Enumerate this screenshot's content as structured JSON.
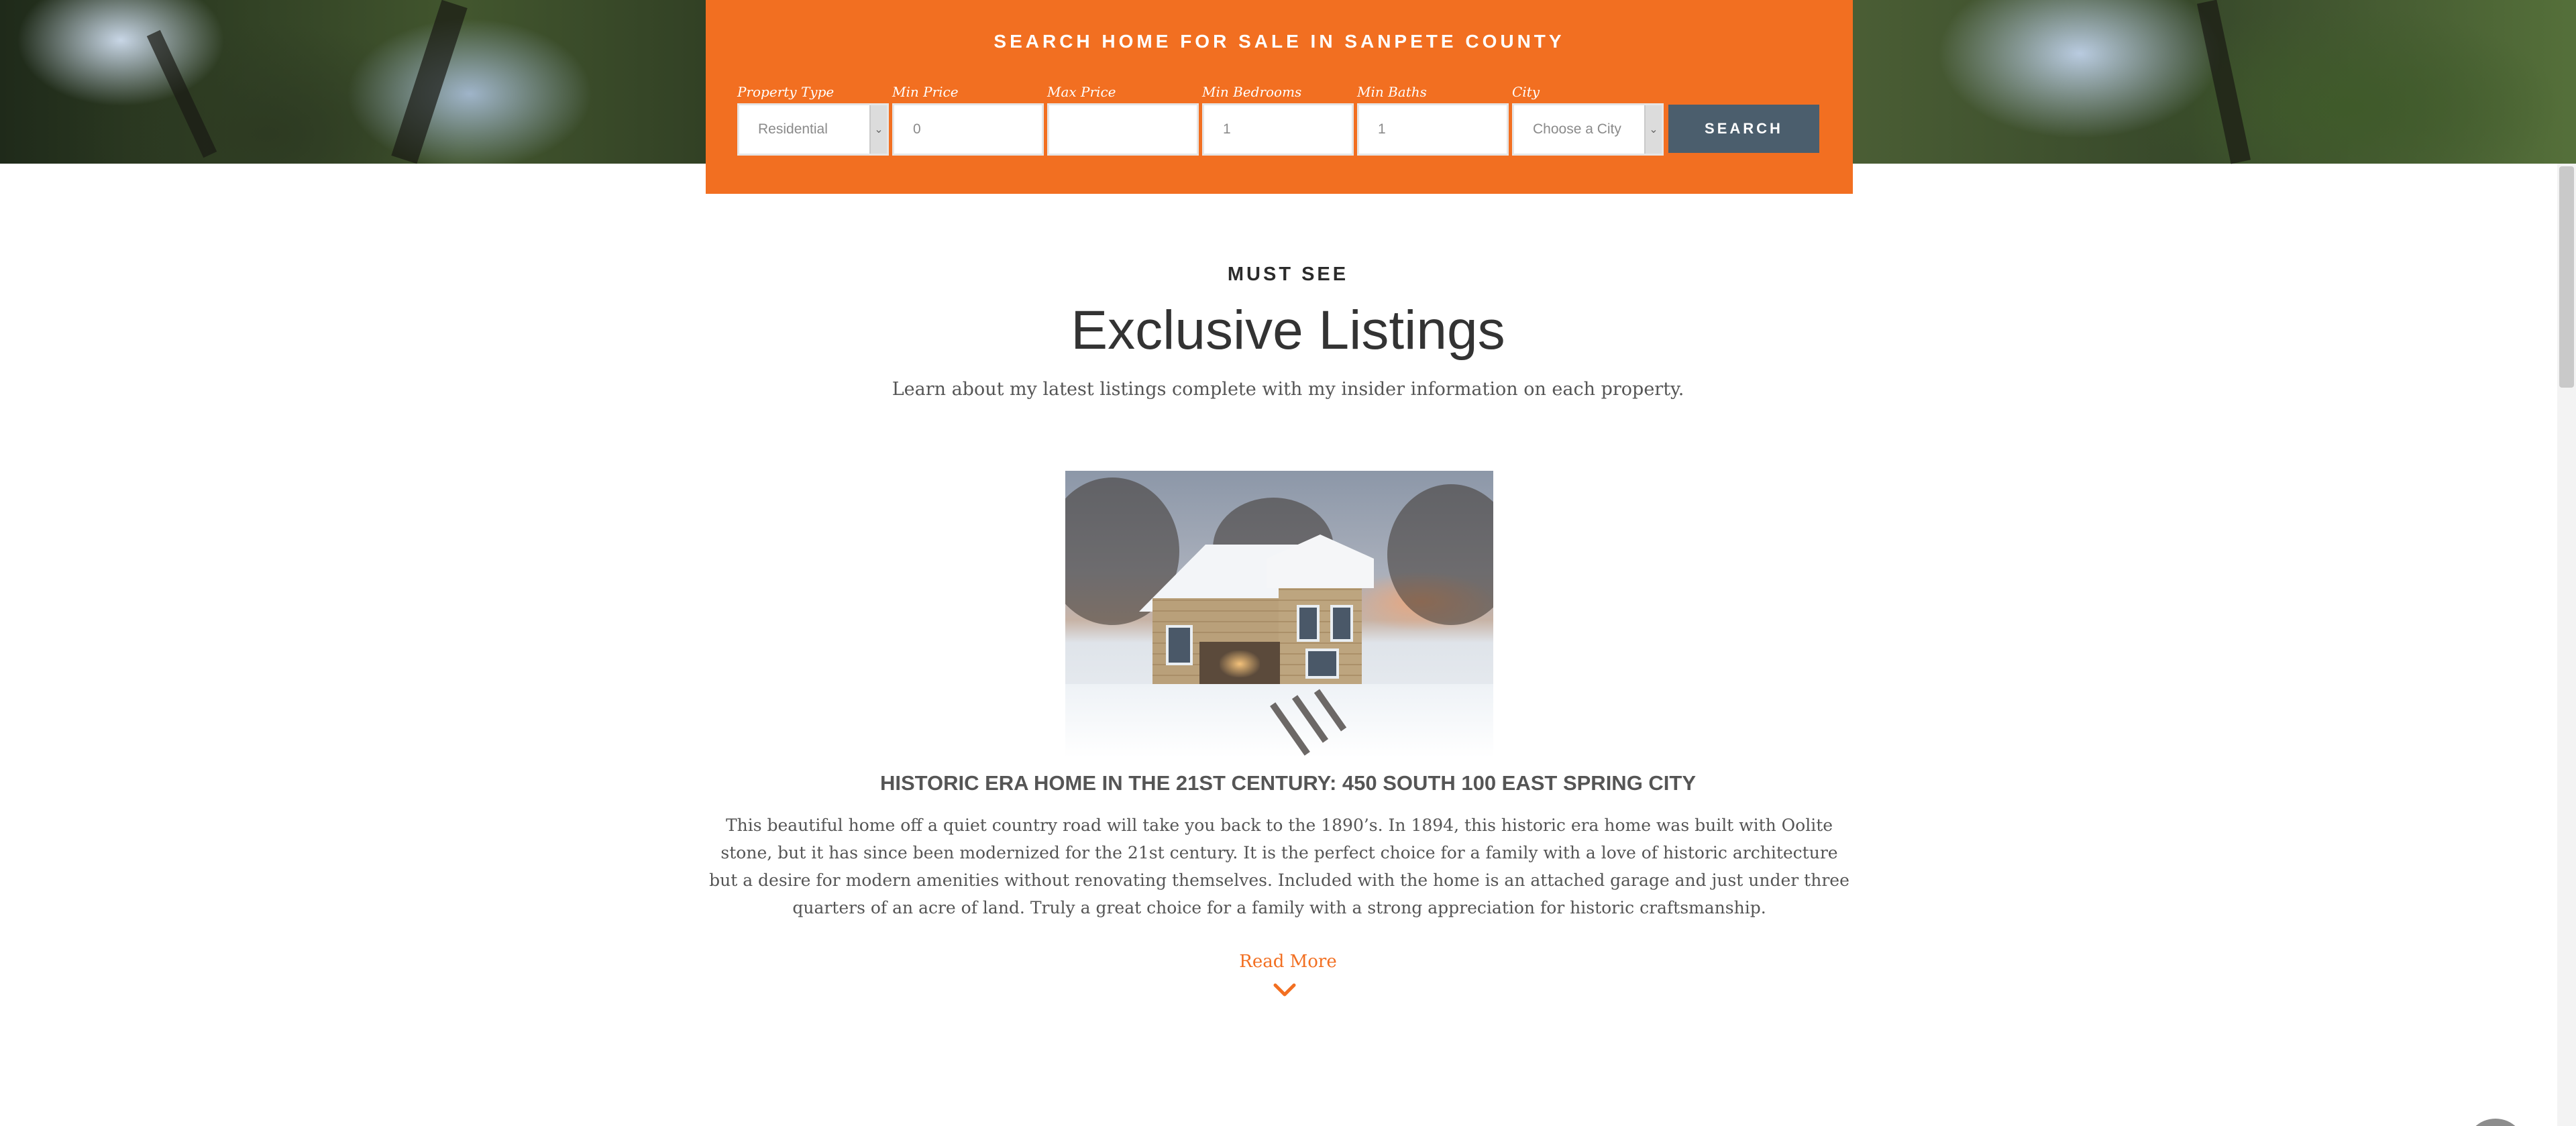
{
  "search": {
    "title": "SEARCH HOME FOR SALE IN SANPETE COUNTY",
    "fields": [
      {
        "label": "Property Type",
        "value": "Residential",
        "kind": "select"
      },
      {
        "label": "Min Price",
        "value": "0",
        "kind": "input"
      },
      {
        "label": "Max Price",
        "value": "",
        "kind": "input"
      },
      {
        "label": "Min Bedrooms",
        "value": "1",
        "kind": "input"
      },
      {
        "label": "Min Baths",
        "value": "1",
        "kind": "input"
      },
      {
        "label": "City",
        "value": "Choose a City",
        "kind": "select"
      }
    ],
    "button_label": "SEARCH"
  },
  "section": {
    "eyebrow": "MUST SEE",
    "title": "Exclusive Listings",
    "subtitle": "Learn about my latest listings complete with my insider information on each property."
  },
  "listing": {
    "title": "HISTORIC ERA HOME IN THE 21ST CENTURY: 450 SOUTH 100 EAST SPRING CITY",
    "description": "This beautiful home off a quiet country road will take you back to the 1890’s. In 1894, this historic era home was built with Oolite stone, but it has since been modernized for the 21st century. It is the perfect choice for a family with a love of historic architecture but a desire for modern amenities without renovating themselves. Included with the home is an attached garage and just under three quarters of an acre of land. Truly a great choice for a family with a strong appreciation for historic craftsmanship.",
    "read_more": "Read More",
    "photo": "house-photo"
  },
  "colors": {
    "accent": "#f26f21",
    "button": "#4b5e6d",
    "heading": "#333333",
    "text": "#555555"
  }
}
